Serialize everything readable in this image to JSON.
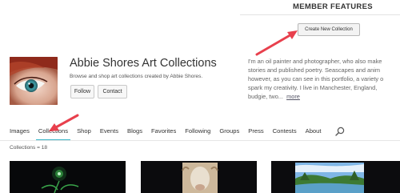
{
  "member_features": {
    "title": "MEMBER FEATURES",
    "create_label": "Create New Collection"
  },
  "profile": {
    "name": "Abbie Shores Art Collections",
    "subtitle": "Browse and shop art collections created by Abbie Shores.",
    "follow_label": "Follow",
    "contact_label": "Contact",
    "bio_lines": [
      "I'm an oil painter and photographer, who also make",
      "stories and published poetry.   Seascapes and anim",
      "however, as you can see in this portfolio, a variety o",
      "spark my creativity.   I live in Manchester, England,",
      "budgie, two..."
    ],
    "more_label": "more"
  },
  "tabs": {
    "items": [
      {
        "label": "Images"
      },
      {
        "label": "Collections"
      },
      {
        "label": "Shop"
      },
      {
        "label": "Events"
      },
      {
        "label": "Blogs"
      },
      {
        "label": "Favorites"
      },
      {
        "label": "Following"
      },
      {
        "label": "Groups"
      },
      {
        "label": "Press"
      },
      {
        "label": "Contests"
      },
      {
        "label": "About"
      }
    ],
    "active": "Collections",
    "search_icon": "search-icon"
  },
  "collections": {
    "count_text": "Collections = 18"
  },
  "colors": {
    "active_tab_underline": "#37b5c8",
    "annotation_arrow": "#e8404d"
  }
}
